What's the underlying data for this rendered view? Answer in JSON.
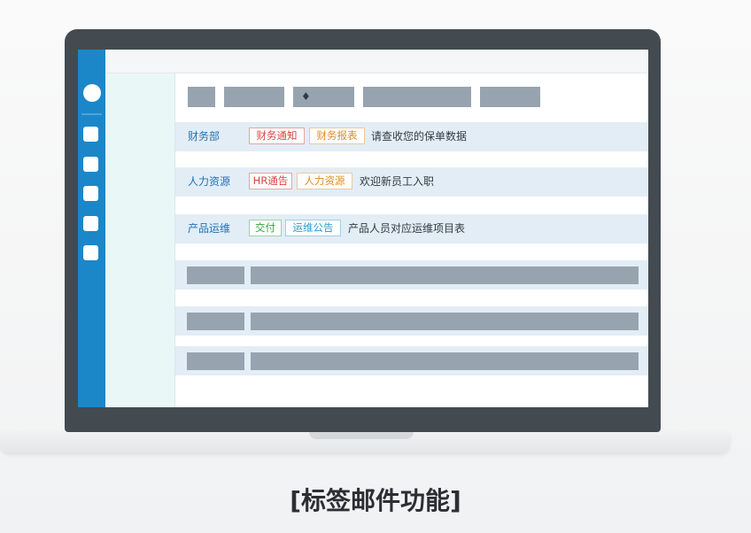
{
  "toolbar": {
    "buttons": [
      {
        "icon": ""
      },
      {
        "icon": ""
      },
      {
        "icon": "tag-icon"
      },
      {
        "icon": ""
      },
      {
        "icon": ""
      }
    ]
  },
  "mail_list": [
    {
      "department": "财务部",
      "tags": [
        {
          "label": "财务通知",
          "color": "#d9443f"
        },
        {
          "label": "财务报表",
          "color": "#e08a23"
        }
      ],
      "subject": "请查收您的保单数据"
    },
    {
      "department": "人力资源",
      "tags": [
        {
          "label": "HR通告",
          "color": "#d9443f"
        },
        {
          "label": "人力资源",
          "color": "#e08a23"
        }
      ],
      "subject": "欢迎新员工入职"
    },
    {
      "department": "产品运维",
      "tags": [
        {
          "label": "交付",
          "color": "#3aa148"
        },
        {
          "label": "运维公告",
          "color": "#2b9ac8"
        }
      ],
      "subject": "产品人员对应运维项目表"
    }
  ],
  "caption": "[标签邮件功能]",
  "colors": {
    "sidebar": "#1b87c9",
    "laptop_frame": "#434a50",
    "row_background": "#e3edf6",
    "placeholder": "#97a4af"
  }
}
